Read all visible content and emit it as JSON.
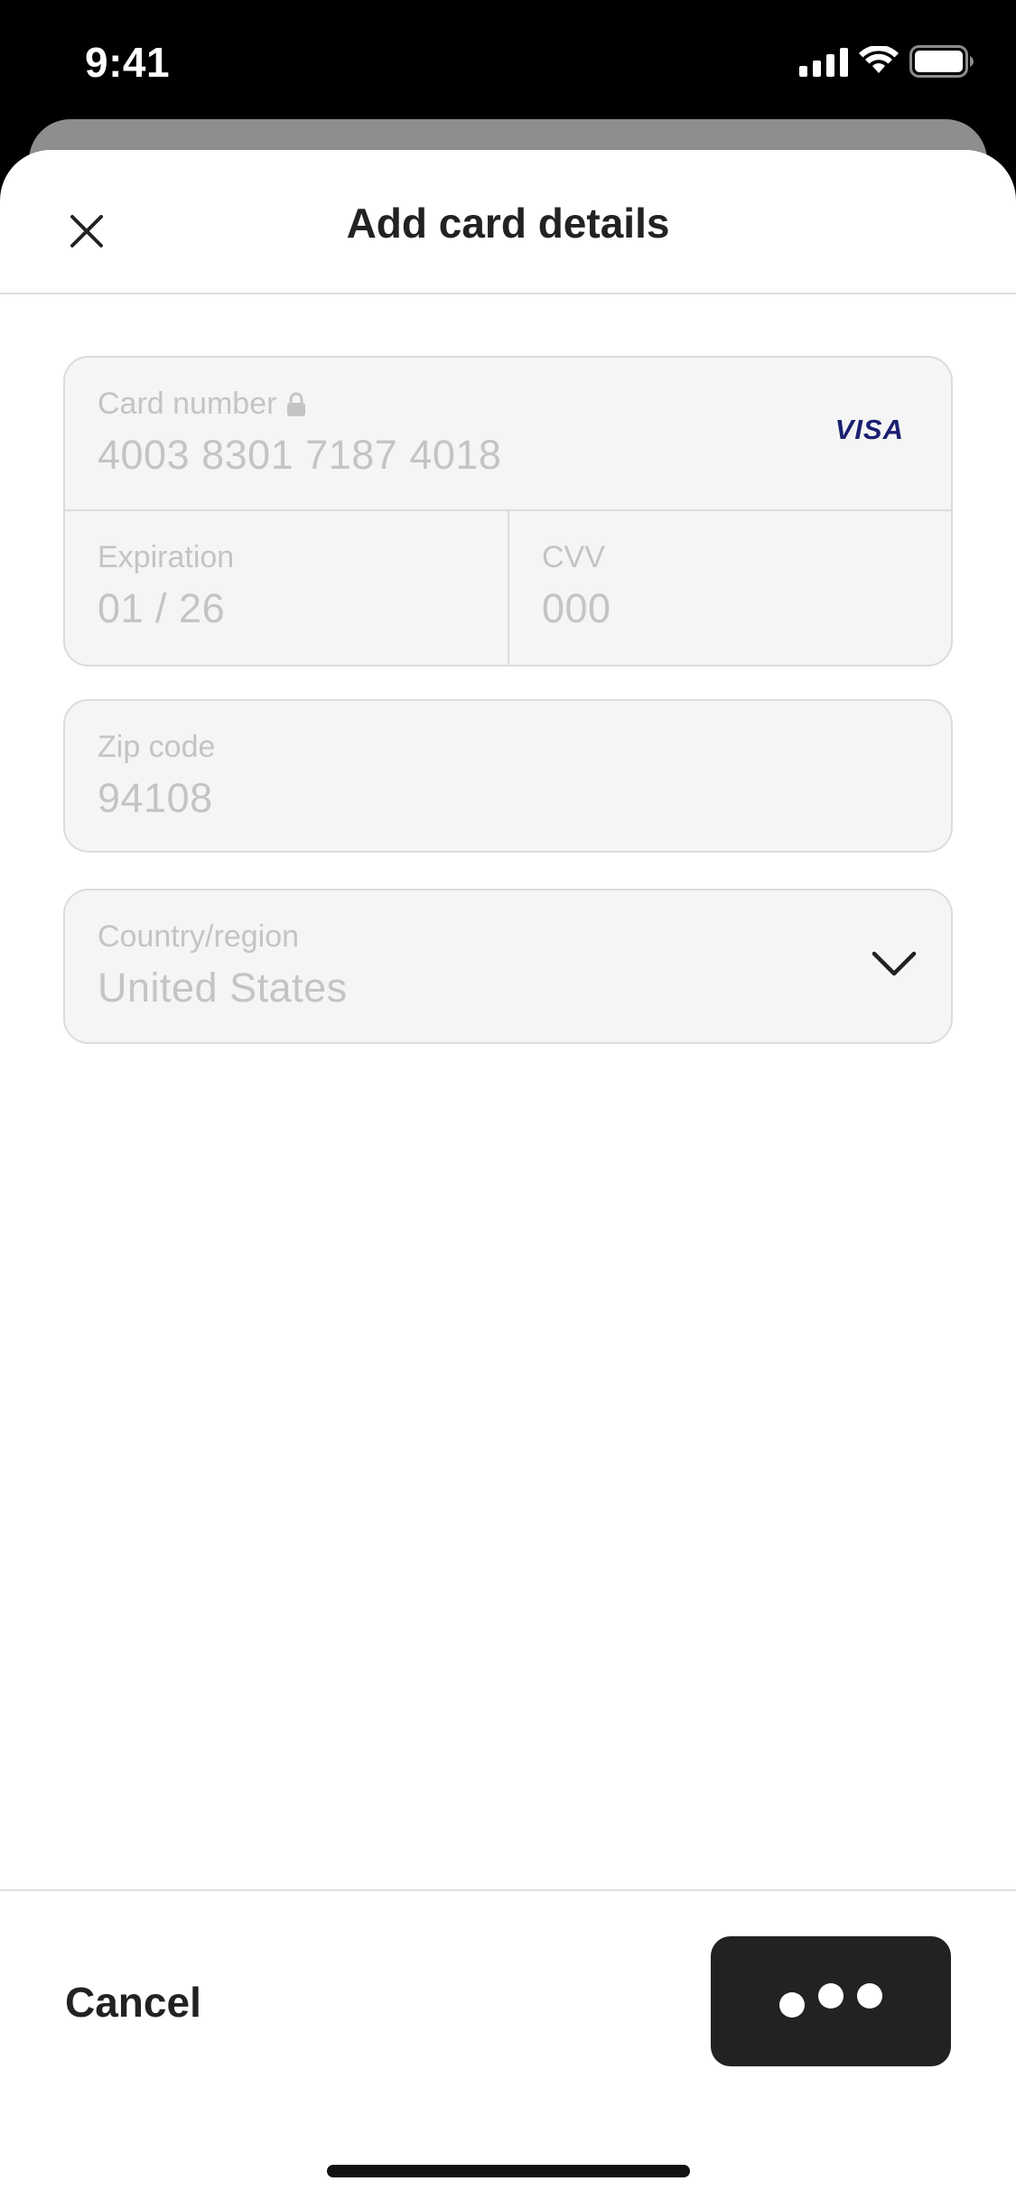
{
  "status_bar": {
    "time": "9:41",
    "icons": [
      "signal-icon",
      "wifi-icon",
      "battery-icon"
    ]
  },
  "sheet": {
    "title": "Add card details",
    "close_icon": "close-icon"
  },
  "form": {
    "card_number": {
      "label": "Card number",
      "value": "4003 8301 7187 4018",
      "brand": "VISA",
      "lock_icon": "lock-icon"
    },
    "expiration": {
      "label": "Expiration",
      "value": "01 / 26"
    },
    "cvv": {
      "label": "CVV",
      "value": "000"
    },
    "zip": {
      "label": "Zip code",
      "value": "94108"
    },
    "country": {
      "label": "Country/region",
      "value": "United States",
      "icon": "chevron-down-icon"
    }
  },
  "footer": {
    "cancel_label": "Cancel",
    "submit_state": "loading-dots-icon"
  },
  "colors": {
    "text_primary": "#222222",
    "field_bg": "#f5f5f5",
    "field_text_disabled": "#c4c4c4",
    "visa_blue": "#1a1f71",
    "button_dark": "#222222"
  }
}
